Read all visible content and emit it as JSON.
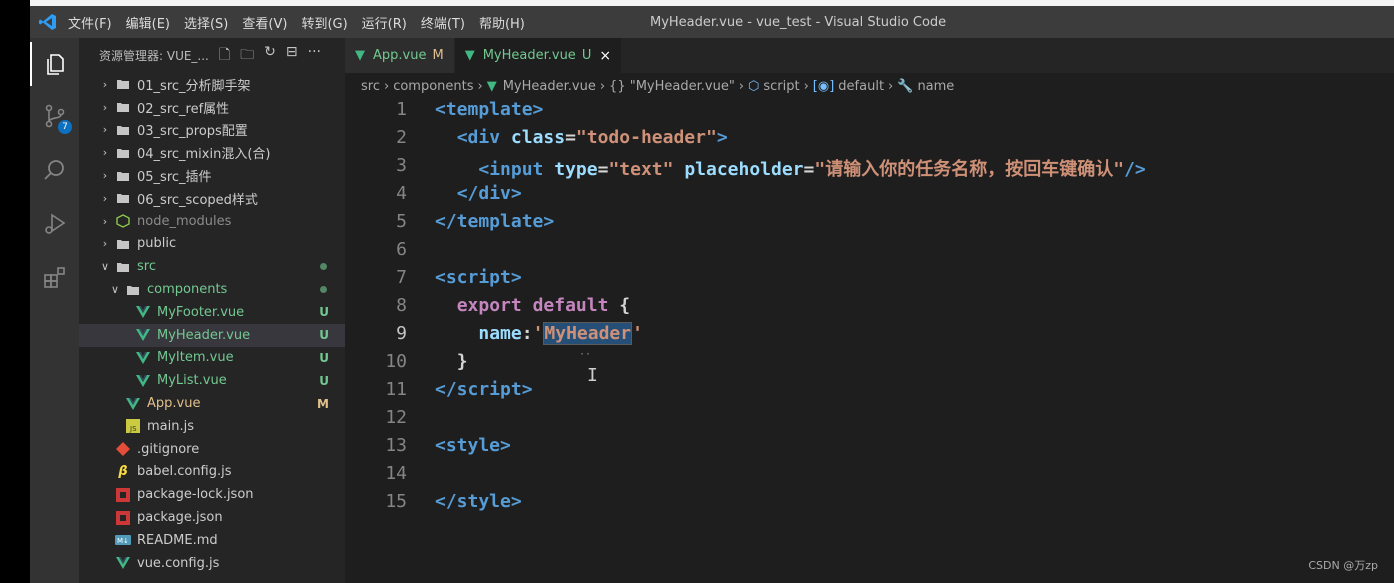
{
  "window": {
    "title": "MyHeader.vue - vue_test - Visual Studio Code",
    "menu": [
      "文件(F)",
      "编辑(E)",
      "选择(S)",
      "查看(V)",
      "转到(G)",
      "运行(R)",
      "终端(T)",
      "帮助(H)"
    ]
  },
  "activity_bar": {
    "items": [
      {
        "icon": "files-icon"
      },
      {
        "icon": "source-control-icon",
        "badge": "7"
      },
      {
        "icon": "search-icon"
      },
      {
        "icon": "run-debug-icon"
      },
      {
        "icon": "extensions-icon"
      }
    ]
  },
  "explorer": {
    "title": "资源管理器: VUE_...",
    "actions": [
      "new-file-icon",
      "new-folder-icon",
      "refresh-icon",
      "collapse-all-icon",
      "more-icon"
    ],
    "items": [
      {
        "label": "01_src_分析脚手架",
        "type": "folder",
        "expanded": false
      },
      {
        "label": "02_src_ref属性",
        "type": "folder",
        "expanded": false
      },
      {
        "label": "03_src_props配置",
        "type": "folder",
        "expanded": false
      },
      {
        "label": "04_src_mixin混入(合)",
        "type": "folder",
        "expanded": false
      },
      {
        "label": "05_src_插件",
        "type": "folder",
        "expanded": false
      },
      {
        "label": "06_src_scoped样式",
        "type": "folder",
        "expanded": false
      },
      {
        "label": "node_modules",
        "type": "node-folder",
        "expanded": false
      },
      {
        "label": "public",
        "type": "folder",
        "expanded": false
      },
      {
        "label": "src",
        "type": "folder",
        "expanded": true,
        "status": "dot"
      },
      {
        "label": "components",
        "type": "folder",
        "expanded": true,
        "status": "dot"
      },
      {
        "label": "MyFooter.vue",
        "type": "vue",
        "status": "U"
      },
      {
        "label": "MyHeader.vue",
        "type": "vue",
        "status": "U",
        "selected": true
      },
      {
        "label": "MyItem.vue",
        "type": "vue",
        "status": "U"
      },
      {
        "label": "MyList.vue",
        "type": "vue",
        "status": "U"
      },
      {
        "label": "App.vue",
        "type": "vue",
        "status": "M"
      },
      {
        "label": "main.js",
        "type": "js"
      },
      {
        "label": ".gitignore",
        "type": "git"
      },
      {
        "label": "babel.config.js",
        "type": "babel"
      },
      {
        "label": "package-lock.json",
        "type": "npm"
      },
      {
        "label": "package.json",
        "type": "npm"
      },
      {
        "label": "README.md",
        "type": "md"
      },
      {
        "label": "vue.config.js",
        "type": "vue"
      }
    ]
  },
  "tabs": [
    {
      "label": "App.vue",
      "status": "M",
      "active": false
    },
    {
      "label": "MyHeader.vue",
      "status": "U",
      "active": true,
      "close": "×"
    }
  ],
  "breadcrumb": {
    "parts": [
      "src",
      "components",
      "MyHeader.vue",
      "{} \"MyHeader.vue\"",
      "script",
      "default",
      "name"
    ]
  },
  "editor": {
    "current_line": 9,
    "line_numbers": [
      "1",
      "2",
      "3",
      "4",
      "5",
      "6",
      "7",
      "8",
      "9",
      "10",
      "11",
      "12",
      "13",
      "14",
      "15"
    ]
  },
  "watermark": "CSDN @万zp",
  "colors": {
    "accent": "#0e70c0",
    "untracked": "#73c991",
    "modified": "#e2c08d",
    "tag": "#569cd6",
    "attribute": "#9cdcfe",
    "string": "#ce9178",
    "keyword": "#c586c0"
  }
}
